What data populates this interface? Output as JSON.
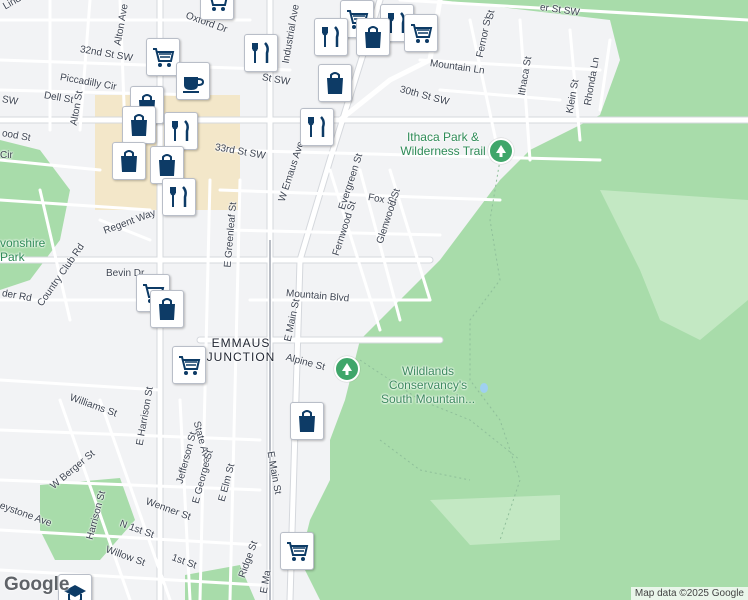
{
  "map": {
    "google_logo": "Google",
    "attribution": "Map data ©2025 Google",
    "place_label": "EMMAUS JUNCTION",
    "colors": {
      "background": "#f2f3f5",
      "park": "#a5dca6",
      "road": "#ffffff",
      "road_edge": "#d5d8dd",
      "poi_green": "#3fa66a",
      "pin_icon": "#0d3b66"
    }
  },
  "parks": {
    "ithaca": "Ithaca Park & Wilderness Trail",
    "wildlands": "Wildlands Conservancy's South Mountain...",
    "devonshire": "vonshire Park"
  },
  "streets": {
    "oxford_dr": "Oxford Dr",
    "alton_ave": "Alton Ave",
    "industrial_ave": "Industrial Ave",
    "st_32nd": "32nd St SW",
    "st_sw": "St SW",
    "piccadilly": "Piccadilly Cir",
    "dell": "Dell St",
    "alton_st": "Alton St",
    "wood_st": "ood St",
    "sw": "SW",
    "cir": "Cir",
    "lind": "Lind",
    "st_33rd": "33rd St SW",
    "st_30th": "30th St SW",
    "mountain_ln": "Mountain Ln",
    "fernor": "Fernor St",
    "ithaca_st": "Ithaca St",
    "klein": "Klein St",
    "rhonda": "Rhonda Ln",
    "er_st_sw": "er St SW",
    "st_top": "St",
    "w_emaus": "W Emaus Ave",
    "evergreen": "Evergreen St",
    "fox": "Fox St",
    "fernwood": "Fernwood St",
    "glenwood": "Glenwood St",
    "e_greenleaf": "E Greenleaf St",
    "regent": "Regent Way",
    "bevin": "Bevin Dr",
    "country_club": "Country Club Rd",
    "der_rd": "der Rd",
    "mountain_blvd": "Mountain Blvd",
    "e_main": "E Main St",
    "e_main_2": "E Main St",
    "alpine": "Alpine St",
    "williams": "Williams St",
    "e_harrison": "E Harrison St",
    "state_ave": "State Ave",
    "w_berger": "W Berger St",
    "jefferson": "Jefferson St",
    "keystone": "eystone Ave",
    "wenner": "Wenner St",
    "e_george": "E George St",
    "e_elm": "E Elm St",
    "harrison": "Harrison St",
    "n_1st": "N 1st St",
    "first_st": "1st St",
    "willow": "Willow St",
    "ridge": "Ridge St",
    "e_ma": "E Ma"
  }
}
